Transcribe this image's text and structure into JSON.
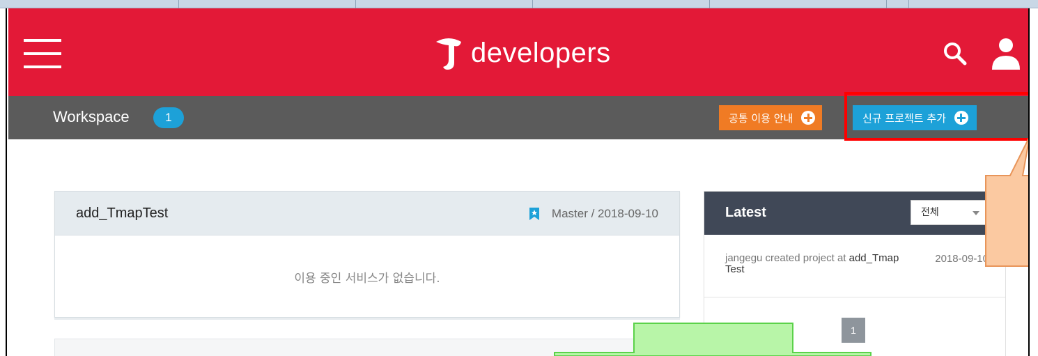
{
  "header": {
    "brand": "developers",
    "colors": {
      "header_bg": "#e31937",
      "bar_bg": "#5b5b5b",
      "accent_blue": "#1da1d8",
      "accent_orange": "#f07b24"
    },
    "icons": {
      "menu": "hamburger-menu-icon",
      "search": "search-icon",
      "user": "user-icon"
    }
  },
  "workspace": {
    "title": "Workspace",
    "count": "1",
    "guide_button": "공통 이용 안내",
    "new_project_button": "신규 프로젝트 추가"
  },
  "project": {
    "name": "add_TmapTest",
    "meta": "Master / 2018-09-10",
    "empty_message": "이용 중인 서비스가 없습니다."
  },
  "latest": {
    "title": "Latest",
    "filter_selected": "전체",
    "items": [
      {
        "actor_text": "jangegu created project at ",
        "project": "add_TmapTest",
        "date": "2018-09-10"
      }
    ],
    "page": "1"
  }
}
